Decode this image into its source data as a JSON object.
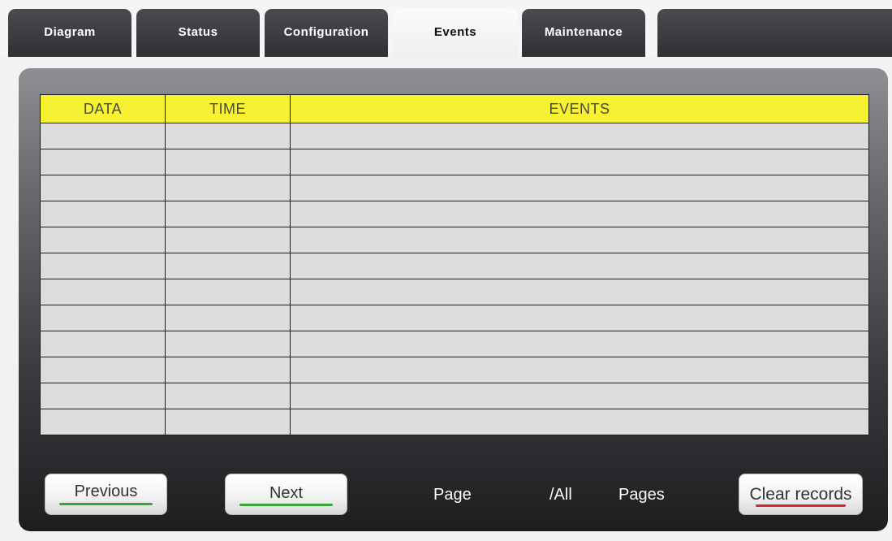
{
  "tabs": {
    "diagram": "Diagram",
    "status": "Status",
    "configuration": "Configuration",
    "events": "Events",
    "maintenance": "Maintenance"
  },
  "active_tab": "Events",
  "table": {
    "headers": [
      "DATA",
      "TIME",
      "EVENTS"
    ],
    "rows": [
      [
        "",
        "",
        ""
      ],
      [
        "",
        "",
        ""
      ],
      [
        "",
        "",
        ""
      ],
      [
        "",
        "",
        ""
      ],
      [
        "",
        "",
        ""
      ],
      [
        "",
        "",
        ""
      ],
      [
        "",
        "",
        ""
      ],
      [
        "",
        "",
        ""
      ],
      [
        "",
        "",
        ""
      ],
      [
        "",
        "",
        ""
      ],
      [
        "",
        "",
        ""
      ],
      [
        "",
        "",
        ""
      ]
    ]
  },
  "footer": {
    "previous_label": "Previous",
    "next_label": "Next",
    "page_label": "Page",
    "all_label": "/All",
    "pages_label": "Pages",
    "clear_label": "Clear records"
  },
  "colors": {
    "header_yellow": "#f6f233",
    "cell_gray": "#dcdcdc",
    "nav_underline": "#3aa63a",
    "clear_underline": "#d62a2a"
  }
}
